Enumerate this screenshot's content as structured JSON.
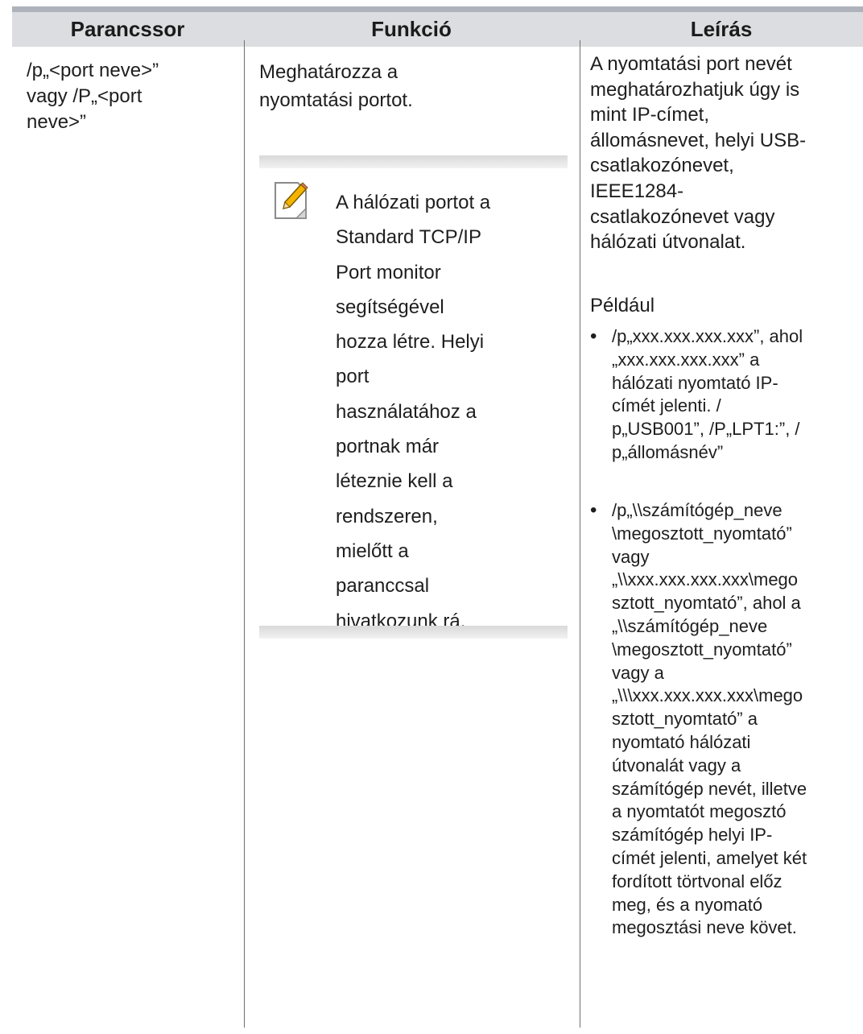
{
  "table": {
    "headers": {
      "col1": "Parancssor",
      "col2": "Funkció",
      "col3": "Leírás"
    },
    "rows": [
      {
        "command": "/p„<port neve>”\nvagy /P„<port\nneve>”",
        "function": "Meghatározza a\nnyomtatási portot.",
        "note": {
          "icon": "note-pencil-icon",
          "text": "A hálózati portot a\nStandard TCP/IP\nPort monitor\nsegítségével\nhozza létre. Helyi\nport\nhasználatához a\nportnak már\nléteznie kell a\nrendszeren,\nmielőtt a\nparanccsal\nhivatkozunk rá."
        },
        "description": "A nyomtatási port nevét\nmeghatározhatjuk úgy is\nmint IP-címet,\nállomásnevet, helyi USB-\ncsatlakozónevet,\nIEEE1284-\ncsatlakozónevet vagy\nhálózati útvonalat.",
        "example_label": "Például",
        "bullets": [
          "/p„xxx.xxx.xxx.xxx”, ahol\n„xxx.xxx.xxx.xxx” a\nhálózati nyomtató IP-\ncímét jelenti. /\np„USB001”, /P„LPT1:”, /\np„állomásnév”",
          "/p„\\\\számítógép_neve\n\\megosztott_nyomtató”\nvagy\n„\\\\xxx.xxx.xxx.xxx\\mego\nsztott_nyomtató”, ahol a\n„\\\\számítógép_neve\n\\megosztott_nyomtató”\nvagy a\n„\\\\\\xxx.xxx.xxx.xxx\\mego\nsztott_nyomtató” a\nnyomtató hálózati\nútvonalát vagy a\nszámítógép nevét, illetve\na nyomtatót megosztó\nszámítógép helyi IP-\ncímét jelenti, amelyet két\nfordított törtvonal előz\nmeg, és a nyomató\nmegosztási neve követ."
        ]
      }
    ]
  },
  "colors": {
    "header_background": "#dcdde1",
    "top_rule": "#aeb2bb",
    "column_rule": "#6f6f6f",
    "note_bar": "#d9d9d9"
  }
}
